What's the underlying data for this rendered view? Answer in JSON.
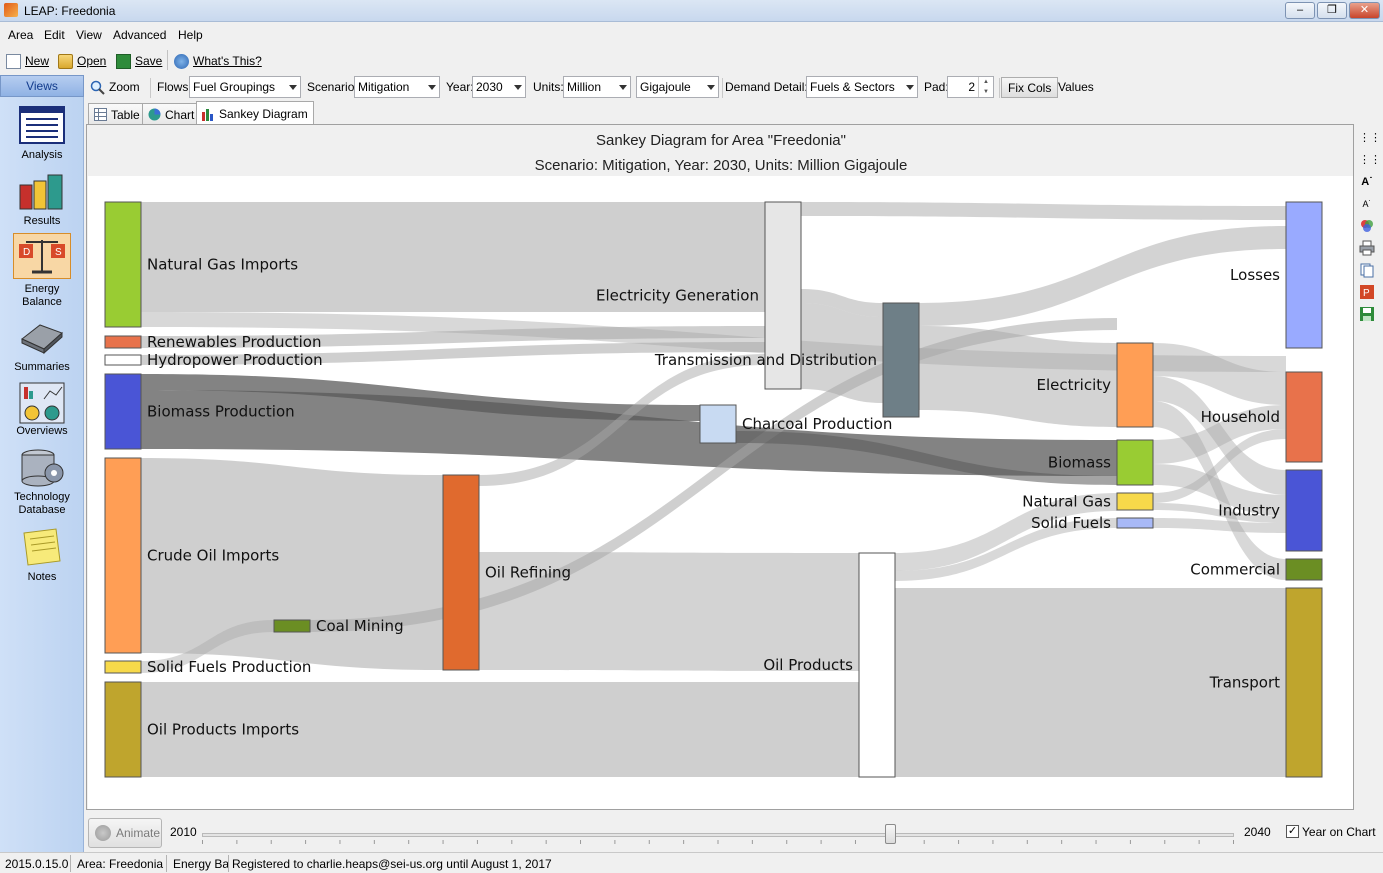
{
  "window": {
    "title": "LEAP: Freedonia"
  },
  "menu": [
    "Area",
    "Edit",
    "View",
    "Advanced",
    "Help"
  ],
  "toolbar": {
    "new": "New",
    "open": "Open",
    "save": "Save",
    "whats_this": "What's This?"
  },
  "views_header": "Views",
  "sidebar": [
    {
      "label": "Analysis",
      "icon": "analysis-icon"
    },
    {
      "label": "Results",
      "icon": "results-icon"
    },
    {
      "label": "Energy\nBalance",
      "icon": "energy-balance-icon"
    },
    {
      "label": "Summaries",
      "icon": "summaries-icon"
    },
    {
      "label": "Overviews",
      "icon": "overviews-icon"
    },
    {
      "label": "Technology\nDatabase",
      "icon": "technology-database-icon"
    },
    {
      "label": "Notes",
      "icon": "notes-icon"
    }
  ],
  "options": {
    "zoom": "Zoom",
    "flows_label": "Flows:",
    "flows_value": "Fuel Groupings",
    "scenario_label": "Scenario:",
    "scenario_value": "Mitigation",
    "year_label": "Year:",
    "year_value": "2030",
    "units_label": "Units:",
    "units_value": "Million",
    "units_value2": "Gigajoule",
    "demand_label": "Demand Detail:",
    "demand_value": "Fuels & Sectors",
    "pad_label": "Pad:",
    "pad_value": "2",
    "fix_cols": "Fix Cols",
    "values": "Values"
  },
  "tabs": [
    "Table",
    "Chart",
    "Sankey Diagram"
  ],
  "diagram": {
    "title": "Sankey Diagram for Area \"Freedonia\"",
    "subtitle": "Scenario: Mitigation, Year: 2030, Units: Million Gigajoule",
    "nodes": [
      {
        "id": "ngi",
        "label": "Natural Gas Imports",
        "color": "#99cc33"
      },
      {
        "id": "ren",
        "label": "Renewables Production",
        "color": "#e8724b"
      },
      {
        "id": "hyd",
        "label": "Hydropower Production",
        "color": "#ffffff"
      },
      {
        "id": "bio",
        "label": "Biomass Production",
        "color": "#4a55d6"
      },
      {
        "id": "coi",
        "label": "Crude Oil Imports",
        "color": "#ff9e55"
      },
      {
        "id": "sfp",
        "label": "Solid Fuels Production",
        "color": "#f7d94a"
      },
      {
        "id": "opi",
        "label": "Oil Products Imports",
        "color": "#bfa52d"
      },
      {
        "id": "coal",
        "label": "Coal Mining",
        "color": "#6b8e23"
      },
      {
        "id": "ref",
        "label": "Oil Refining",
        "color": "#e06a2e"
      },
      {
        "id": "egen",
        "label": "Electricity Generation",
        "color": "#e6e6e6"
      },
      {
        "id": "char",
        "label": "Charcoal Production",
        "color": "#c8daf2"
      },
      {
        "id": "oprod",
        "label": "Oil Products",
        "color": "#ffffff"
      },
      {
        "id": "tnd",
        "label": "Transmission and Distribution",
        "color": "#6e7f87"
      },
      {
        "id": "elec",
        "label": "Electricity",
        "color": "#ff9e55"
      },
      {
        "id": "biof",
        "label": "Biomass",
        "color": "#99cc33"
      },
      {
        "id": "ngf",
        "label": "Natural Gas",
        "color": "#f7d94a"
      },
      {
        "id": "sff",
        "label": "Solid Fuels",
        "color": "#a8b9f7"
      },
      {
        "id": "loss",
        "label": "Losses",
        "color": "#99aaff"
      },
      {
        "id": "hh",
        "label": "Household",
        "color": "#e8724b"
      },
      {
        "id": "ind",
        "label": "Industry",
        "color": "#4a55d6"
      },
      {
        "id": "com",
        "label": "Commercial",
        "color": "#6b8e23"
      },
      {
        "id": "tra",
        "label": "Transport",
        "color": "#bfa52d"
      }
    ]
  },
  "animation": {
    "button": "Animate",
    "start_year": "2010",
    "end_year": "2040",
    "current_year": 2030,
    "year_on_chart": "Year on Chart"
  },
  "status": {
    "version": "2015.0.15.0",
    "area": "Area: Freedonia",
    "view": "Energy Ba",
    "registration": "Registered to charlie.heaps@sei-us.org until August 1, 2017"
  }
}
